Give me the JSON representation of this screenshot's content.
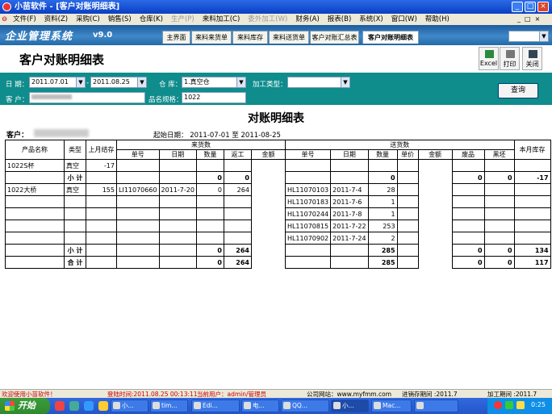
{
  "window": {
    "title": "小苗软件 - [客户对账明细表]",
    "min": "_",
    "max": "□",
    "close": "×",
    "inner_min": "_",
    "inner_max": "□",
    "inner_close": "×"
  },
  "menu": [
    {
      "label": "文件(F)",
      "enabled": true
    },
    {
      "label": "资料(Z)",
      "enabled": true
    },
    {
      "label": "采购(C)",
      "enabled": true
    },
    {
      "label": "销售(S)",
      "enabled": true
    },
    {
      "label": "仓库(K)",
      "enabled": true
    },
    {
      "label": "生产(P)",
      "enabled": false
    },
    {
      "label": "来料加工(C)",
      "enabled": true
    },
    {
      "label": "委外加工(W)",
      "enabled": false
    },
    {
      "label": "财务(A)",
      "enabled": true
    },
    {
      "label": "报表(B)",
      "enabled": true
    },
    {
      "label": "系统(X)",
      "enabled": true
    },
    {
      "label": "窗口(W)",
      "enabled": true
    },
    {
      "label": "帮助(H)",
      "enabled": true
    }
  ],
  "brand": {
    "name": "企业管理系统",
    "version": "v9.0"
  },
  "nav_tabs": [
    {
      "label": "主界面"
    },
    {
      "label": "来料来货单"
    },
    {
      "label": "来料库存"
    },
    {
      "label": "来料送货单"
    },
    {
      "label": "客户对账汇总表"
    },
    {
      "label": "客户对账明细表",
      "active": true
    }
  ],
  "header": {
    "title": "客户对账明细表",
    "excel_label": "Excel",
    "print_label": "打印",
    "close_label": "关闭"
  },
  "filter": {
    "date_label": "日 期：",
    "date_from": "2011.07.01",
    "date_sep": "-",
    "date_to": "2011.08.25",
    "warehouse_label": "仓 库：",
    "warehouse_value": "1.真空仓",
    "process_label": "加工类型：",
    "process_value": "",
    "client_label": "客 户：",
    "client_value": "",
    "product_label": "品名规格：",
    "product_value": "1022",
    "query_label": "查询"
  },
  "report": {
    "title": "对账明细表",
    "client_label": "客户：",
    "date_range": "起始日期： 2011-07-01 至 2011-08-25",
    "group_headers": {
      "incoming": "来货数",
      "delivery": "送货数"
    },
    "columns": {
      "product": "产品名称",
      "type": "类型",
      "prev_stock": "上月结存",
      "in_no": "单号",
      "in_date": "日期",
      "in_qty": "数量",
      "in_return": "返工",
      "amount": "金额",
      "out_no": "单号",
      "out_date": "日期",
      "out_qty": "数量",
      "out_price": "单价",
      "out_amount": "金额",
      "waste": "废品",
      "bad": "黑坯",
      "month_stock": "本月库存"
    },
    "rows": [
      {
        "cells": [
          "1022S杯",
          "真空",
          "-17",
          "",
          "",
          "",
          "",
          "",
          "",
          "",
          "",
          "",
          "",
          "",
          "",
          ""
        ]
      },
      {
        "cells": [
          "",
          "小 计",
          "",
          "",
          "",
          "0",
          "0",
          "",
          "",
          "",
          "0",
          "",
          "",
          "0",
          "0",
          "-17"
        ],
        "bold": true
      },
      {
        "cells": [
          "1022大桥",
          "真空",
          "155",
          "LI11070660",
          "2011-7-20",
          "0",
          "264",
          "",
          "HL11070103",
          "2011-7-4",
          "28",
          "",
          "",
          "",
          "",
          ""
        ]
      },
      {
        "cells": [
          "",
          "",
          "",
          "",
          "",
          "",
          "",
          "",
          "HL11070183",
          "2011-7-6",
          "1",
          "",
          "",
          "",
          "",
          ""
        ]
      },
      {
        "cells": [
          "",
          "",
          "",
          "",
          "",
          "",
          "",
          "",
          "HL11070244",
          "2011-7-8",
          "1",
          "",
          "",
          "",
          "",
          ""
        ]
      },
      {
        "cells": [
          "",
          "",
          "",
          "",
          "",
          "",
          "",
          "",
          "HL11070815",
          "2011-7-22",
          "253",
          "",
          "",
          "",
          "",
          ""
        ]
      },
      {
        "cells": [
          "",
          "",
          "",
          "",
          "",
          "",
          "",
          "",
          "HL11070902",
          "2011-7-24",
          "2",
          "",
          "",
          "",
          "",
          ""
        ]
      },
      {
        "cells": [
          "",
          "小 计",
          "",
          "",
          "",
          "0",
          "264",
          "",
          "",
          "",
          "285",
          "",
          "",
          "0",
          "0",
          "134"
        ],
        "bold": true
      },
      {
        "cells": [
          "",
          "合 计",
          "",
          "",
          "",
          "0",
          "264",
          "",
          "",
          "",
          "285",
          "",
          "",
          "0",
          "0",
          "117"
        ],
        "bold": true
      }
    ]
  },
  "status": {
    "welcome": "欢迎使用小苗软件！",
    "login_time": "登陆时间:2011.08.25 00:13:11",
    "current_user": "当前用户：admin/管理员",
    "website": "公司网站：www.myfmm.com",
    "stock_period": "进销存期间 :2011.7",
    "process_period": "加工期间 :2011.7"
  },
  "taskbar": {
    "start": "开始",
    "tasks": [
      "小...",
      "tim...",
      "Edi...",
      "电...",
      "QQ...",
      "小...",
      "Mac...",
      ""
    ],
    "clock": "0:25"
  }
}
